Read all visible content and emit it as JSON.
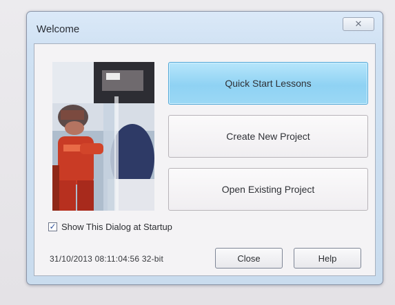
{
  "dialog": {
    "title": "Welcome",
    "close_glyph": "✕"
  },
  "actions": {
    "quick_start": "Quick Start Lessons",
    "create_new": "Create New Project",
    "open_existing": "Open Existing Project"
  },
  "startup": {
    "checked": true,
    "check_glyph": "✓",
    "label": "Show This Dialog at Startup"
  },
  "footer": {
    "version_text": "31/10/2013  08:11:04:56  32-bit",
    "close_label": "Close",
    "help_label": "Help"
  },
  "image": {
    "subject": "firefighter-with-hydrant-photo"
  },
  "colors": {
    "primary_button": "#9bd8f5",
    "window_frame": "#c9dcee"
  }
}
